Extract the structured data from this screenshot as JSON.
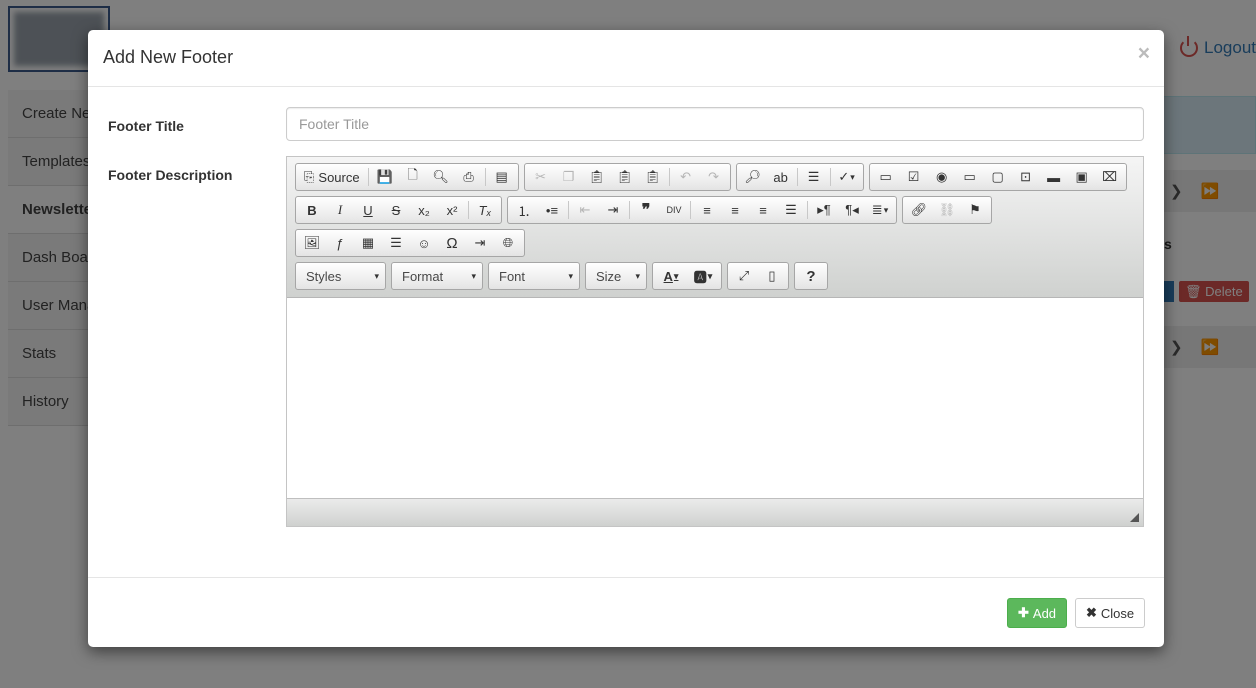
{
  "background": {
    "logout_label": "Logout",
    "sidebar": [
      "Create New",
      "Templates",
      "Newsletters",
      "Dash Board",
      "User Management",
      "Stats",
      "History"
    ],
    "table_header_fragment": "s",
    "delete_label": "Delete"
  },
  "modal": {
    "title": "Add New Footer",
    "close_glyph": "×",
    "footer_title_label": "Footer Title",
    "footer_title_placeholder": "Footer Title",
    "footer_title_value": "",
    "footer_description_label": "Footer Description",
    "editor": {
      "source_label": "Source",
      "combos": {
        "styles": "Styles",
        "format": "Format",
        "font": "Font",
        "size": "Size"
      },
      "help_glyph": "?",
      "content": ""
    },
    "add_button_label": "Add",
    "close_button_label": "Close"
  },
  "colors": {
    "overlay": "#000000",
    "add_button": "#5cb85c",
    "delete_button": "#d9534f",
    "link": "#337ab7"
  }
}
